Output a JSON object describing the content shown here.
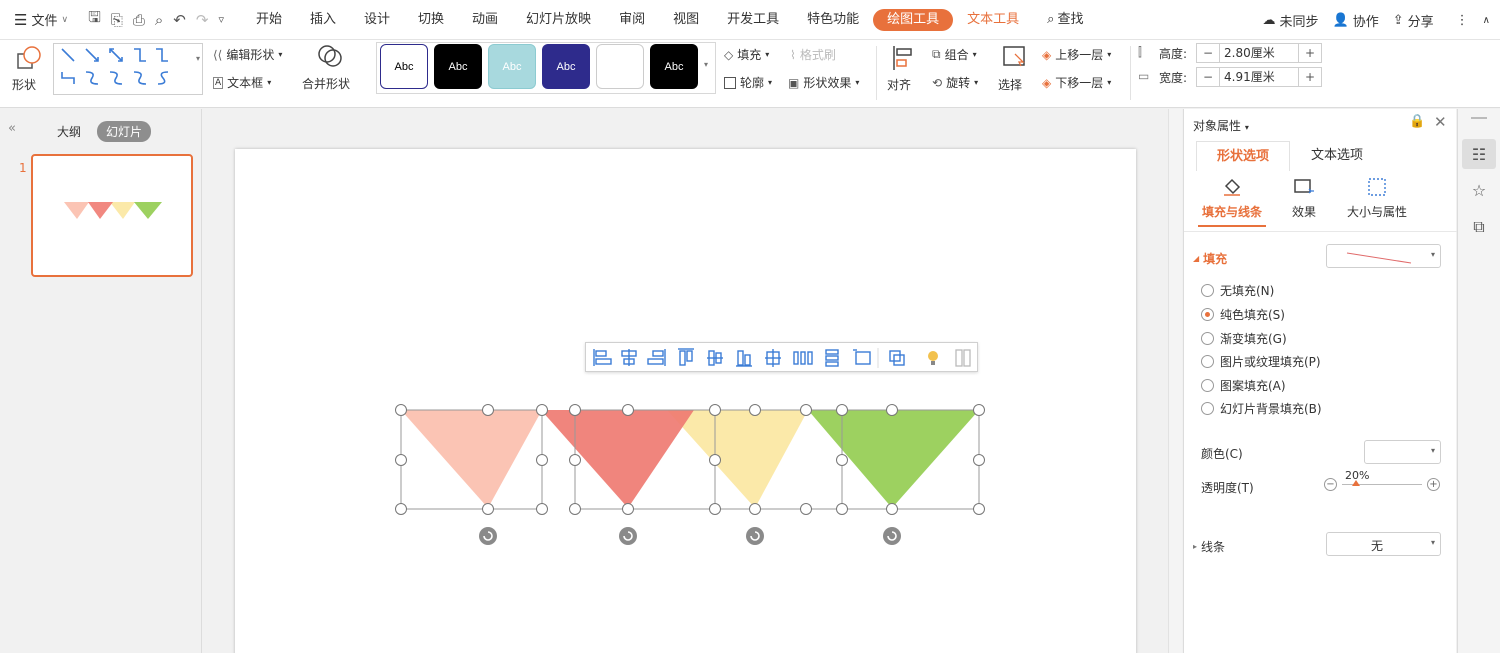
{
  "menubar": {
    "file_label": "文件",
    "tabs": [
      "开始",
      "插入",
      "设计",
      "切换",
      "动画",
      "幻灯片放映",
      "审阅",
      "视图",
      "开发工具",
      "特色功能",
      "绘图工具",
      "文本工具"
    ],
    "active_tab": "绘图工具",
    "search_label": "查找",
    "sync_label": "未同步",
    "collab_label": "协作",
    "share_label": "分享"
  },
  "ribbon": {
    "shape_label": "形状",
    "edit_shape_label": "编辑形状",
    "textbox_label": "文本框",
    "merge_shape_label": "合并形状",
    "style_sample_text": "Abc",
    "style_presets": [
      {
        "bg": "#ffffff",
        "fg": "#000000",
        "border": "#2e2b8c"
      },
      {
        "bg": "#000000",
        "fg": "#ffffff",
        "border": "#000000"
      },
      {
        "bg": "#a8d9de",
        "fg": "#ffffff",
        "border": "#8ccbd1"
      },
      {
        "bg": "#2e2b8c",
        "fg": "#ffffff",
        "border": "#2e2b8c"
      },
      {
        "bg": "#ffffff",
        "fg": "#ffffff",
        "border": "#cccccc"
      },
      {
        "bg": "#000000",
        "fg": "#ffffff",
        "border": "#000000"
      }
    ],
    "fill_label": "填充",
    "format_painter_label": "格式刷",
    "outline_label": "轮廓",
    "shape_effect_label": "形状效果",
    "align_label": "对齐",
    "group_label": "组合",
    "rotate_label": "旋转",
    "select_label": "选择",
    "bring_forward_label": "上移一层",
    "send_backward_label": "下移一层",
    "height_label": "高度:",
    "height_value": "2.80厘米",
    "width_label": "宽度:",
    "width_value": "4.91厘米"
  },
  "left_panel": {
    "outline_tab": "大纲",
    "slides_tab": "幻灯片",
    "slide_number": "1"
  },
  "slide": {
    "triangle_colors": [
      "#fbc4b4",
      "#ef7b72",
      "#fbe9a9",
      "#9dd160"
    ]
  },
  "props": {
    "title": "对象属性",
    "tab_shape": "形状选项",
    "tab_text": "文本选项",
    "subtab_fill": "填充与线条",
    "subtab_effect": "效果",
    "subtab_size": "大小与属性",
    "fill_section": "填充",
    "fill_options": [
      "无填充(N)",
      "纯色填充(S)",
      "渐变填充(G)",
      "图片或纹理填充(P)",
      "图案填充(A)",
      "幻灯片背景填充(B)"
    ],
    "selected_fill_option": "纯色填充(S)",
    "color_label": "颜色(C)",
    "transparency_label": "透明度(T)",
    "transparency_value": "20%",
    "transparency_level": 0.2,
    "line_section": "线条",
    "line_value": "无"
  },
  "colors": {
    "accent": "#e8713c"
  }
}
